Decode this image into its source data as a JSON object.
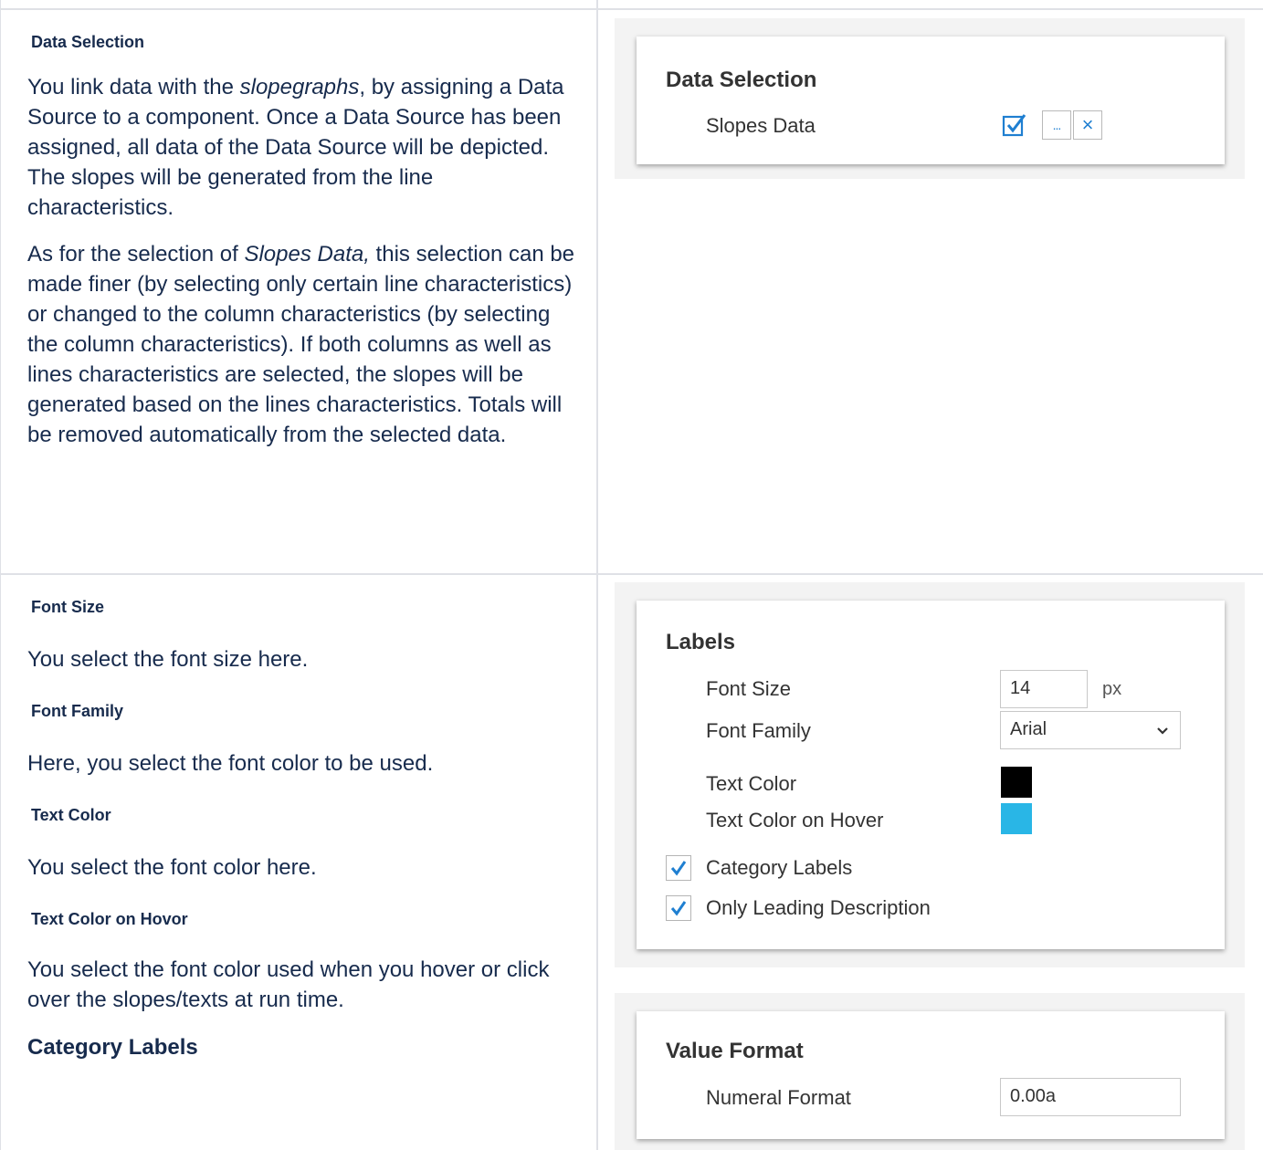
{
  "section1": {
    "heading": "Data Selection",
    "paragraph1_parts": [
      "You link data with the ",
      "slopegraphs",
      ", by assigning a Data Source to a component. Once a Data Source has been assigned, all data of the Data Source will be depicted. The slopes will be generated from the line characteristics."
    ],
    "paragraph2_parts": [
      "As for the selection of ",
      "Slopes Data,",
      " this selection can be made finer (by selecting only certain line characteristics) or changed to the column characteristics (by selecting the column characteristics). If both columns as well as lines characteristics are selected, the slopes will be generated based on the lines characteristics. Totals will be removed automatically from the selected data."
    ]
  },
  "section2": {
    "font_size_heading": "Font Size",
    "font_size_text": "You select the font size here.",
    "font_family_heading": "Font Family",
    "font_family_text": "Here, you select the font color to be used.",
    "text_color_heading": "Text Color",
    "text_color_text": "You select the font color here.",
    "hover_heading": "Text Color on Hovor",
    "hover_text": "You select the font color used when you hover or click over the slopes/texts at run time.",
    "category_heading": "Category Labels"
  },
  "panel_data_selection": {
    "title": "Data Selection",
    "slopes_label": "Slopes Data",
    "icons": [
      "checkbox-edit-icon",
      "more-icon",
      "close-icon"
    ],
    "more_glyph": "...",
    "close_glyph": "×"
  },
  "panel_labels": {
    "title": "Labels",
    "font_size_label": "Font Size",
    "font_size_value": "14",
    "font_size_unit": "px",
    "font_family_label": "Font Family",
    "font_family_value": "Arial",
    "text_color_label": "Text Color",
    "text_color_value": "#000000",
    "hover_color_label": "Text Color on Hover",
    "hover_color_value": "#29b6e6",
    "category_labels": "Category Labels",
    "only_leading": "Only Leading Description",
    "category_checked": true,
    "leading_checked": true,
    "check_color": "#1f7fd1"
  },
  "panel_value_format": {
    "title": "Value Format",
    "numeral_label": "Numeral Format",
    "numeral_value": "0.00a"
  }
}
